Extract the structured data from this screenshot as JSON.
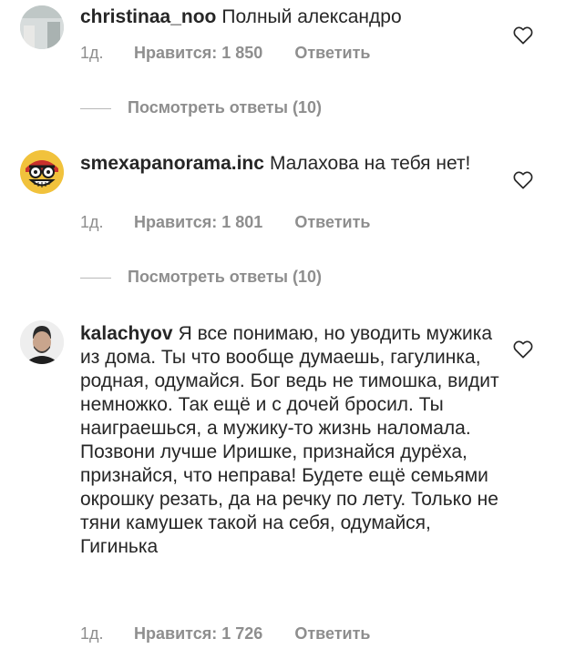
{
  "comments": [
    {
      "username": "christinaa_noo",
      "text": "Полный александро",
      "time": "1д.",
      "likes": "Нравится: 1 850",
      "reply_label": "Ответить",
      "view_replies": "Посмотреть ответы (10)",
      "icon": "heart-outline-icon"
    },
    {
      "username": "smexapanorama.inc",
      "text": "Малахова на тебя нет!",
      "time": "1д.",
      "likes": "Нравится: 1 801",
      "reply_label": "Ответить",
      "view_replies": "Посмотреть ответы (10)",
      "icon": "heart-outline-icon"
    },
    {
      "username": "kalachyov",
      "text": "Я все понимаю, но уводить мужика из дома. Ты что вообще думаешь, гагулинка, родная, одумайся. Бог ведь не тимошка, видит немножко. Так ещё и с дочей бросил. Ты наиграешься, а мужику-то жизнь наломала. Позвони лучше Иришке, признайся дурёха, признайся, что неправа! Будете ещё семьями окрошку резать, да на речку по лету. Только не тяни камушек такой на себя, одумайся, Гигинька",
      "time": "1д.",
      "likes": "Нравится: 1 726",
      "reply_label": "Ответить",
      "icon": "heart-outline-icon"
    }
  ],
  "colors": {
    "text": "#262626",
    "secondary": "#8e8e8e",
    "background": "#ffffff"
  }
}
